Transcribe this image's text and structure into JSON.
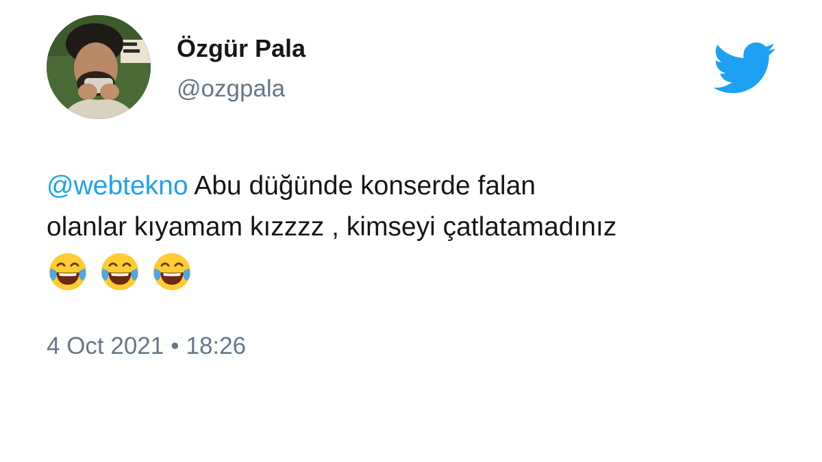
{
  "tweet": {
    "author": {
      "display_name": "Özgür Pala",
      "handle": "@ozgpala",
      "avatar_icon": "profile-photo"
    },
    "brand": {
      "icon": "twitter-bird-icon",
      "color": "#1da1f2"
    },
    "mention": "@webtekno",
    "text_line1_rest": " Abu düğünde konserde falan",
    "text_line2": "olanlar kıyamam kızzzz , kimseyi çatlatamadınız",
    "emoji": {
      "name": "face-with-tears-of-joy",
      "count": 3
    },
    "date": "4 Oct 2021",
    "separator": "•",
    "time": "18:26"
  },
  "colors": {
    "text": "#14171a",
    "secondary": "#657786",
    "link": "#1da1f2"
  }
}
